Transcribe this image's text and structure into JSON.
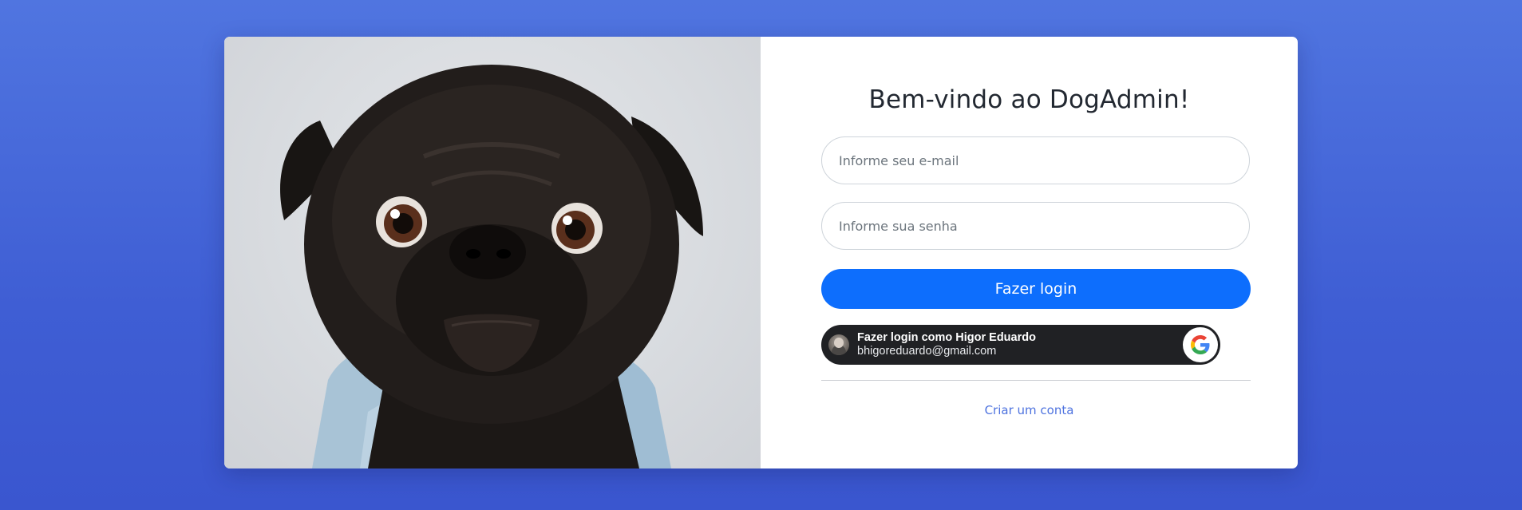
{
  "page": {
    "title": "Bem-vindo ao DogAdmin!",
    "background_color": "#4a6ad9",
    "accent_color": "#0d6efd",
    "link_color": "#4e73df"
  },
  "hero": {
    "image": "pug-in-denim-jacket"
  },
  "form": {
    "email": {
      "value": "",
      "placeholder": "Informe seu e-mail"
    },
    "password": {
      "value": "",
      "placeholder": "Informe sua senha"
    },
    "login_label": "Fazer login"
  },
  "google": {
    "label": "Fazer login como Higor Eduardo",
    "email": "bhigoreduardo@gmail.com",
    "icon": "google-icon"
  },
  "footer": {
    "create_account_label": "Criar um conta"
  }
}
